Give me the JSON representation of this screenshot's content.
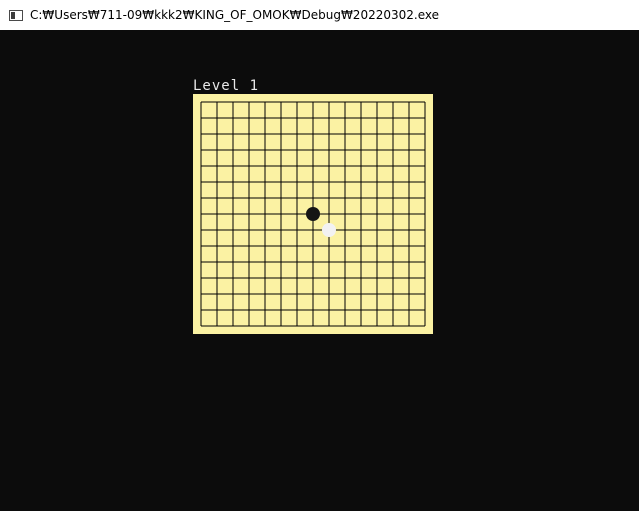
{
  "window": {
    "title": "C:₩Users₩711-09₩kkk2₩KING_OF_OMOK₩Debug₩20220302.exe"
  },
  "game": {
    "level_label": "Level 1",
    "board": {
      "lines": 15,
      "color": "#fbf2a3",
      "line_color": "#000000",
      "stones": [
        {
          "color": "black",
          "col": 7,
          "row": 7
        },
        {
          "color": "white",
          "col": 8,
          "row": 8
        }
      ]
    }
  },
  "colors": {
    "console_bg": "#0c0c0c",
    "titlebar_bg": "#ffffff",
    "black_stone": "#151515",
    "white_stone": "#f2f2f2"
  }
}
